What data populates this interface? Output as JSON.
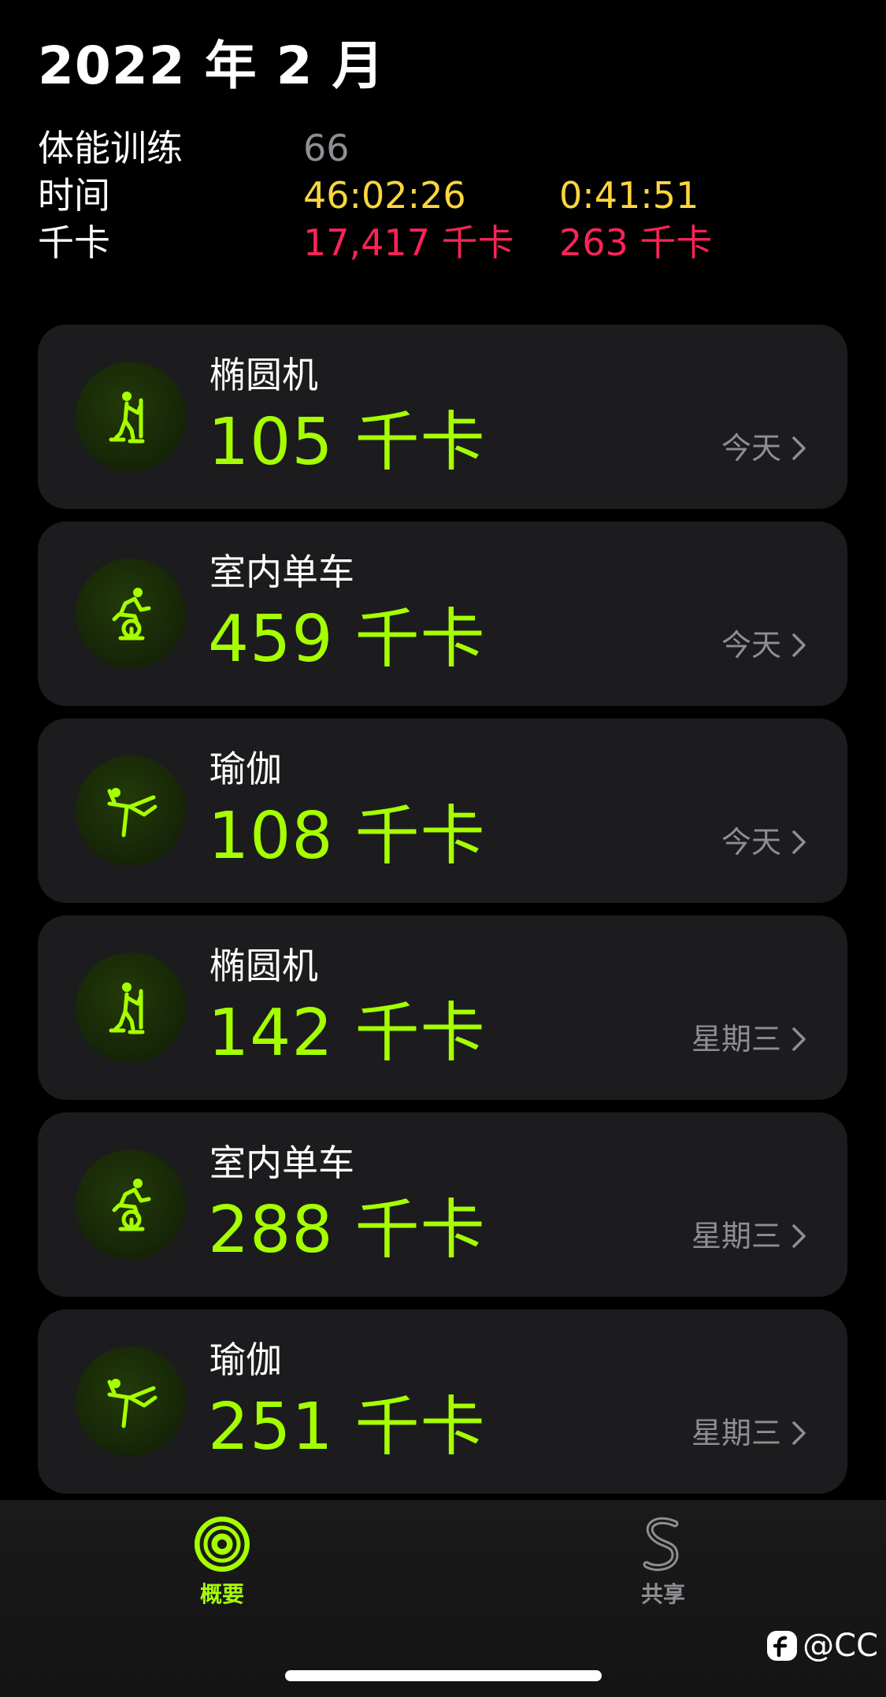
{
  "header": {
    "title": "2022 年 2 月"
  },
  "summary": {
    "workouts_label": "体能训练",
    "workouts_count": "66",
    "time_label": "时间",
    "time_total": "46:02:26",
    "time_avg": "0:41:51",
    "cal_label": "千卡",
    "cal_total": "17,417 千卡",
    "cal_avg": "263 千卡"
  },
  "workouts": [
    {
      "name": "椭圆机",
      "calories": "105 千卡",
      "date": "今天",
      "icon": "elliptical-icon"
    },
    {
      "name": "室内单车",
      "calories": "459 千卡",
      "date": "今天",
      "icon": "indoor-cycle-icon"
    },
    {
      "name": "瑜伽",
      "calories": "108 千卡",
      "date": "今天",
      "icon": "yoga-icon"
    },
    {
      "name": "椭圆机",
      "calories": "142 千卡",
      "date": "星期三",
      "icon": "elliptical-icon"
    },
    {
      "name": "室内单车",
      "calories": "288 千卡",
      "date": "星期三",
      "icon": "indoor-cycle-icon"
    },
    {
      "name": "瑜伽",
      "calories": "251 千卡",
      "date": "星期三",
      "icon": "yoga-icon"
    }
  ],
  "tabbar": {
    "summary_label": "概要",
    "sharing_label": "共享"
  },
  "watermark": {
    "text": "@CC"
  },
  "colors": {
    "move_green": "#a6ff00",
    "time_yellow": "#fdd53e",
    "cal_red": "#fa2457",
    "card_bg": "#1c1c1e",
    "secondary_grey": "#8e8e93"
  }
}
